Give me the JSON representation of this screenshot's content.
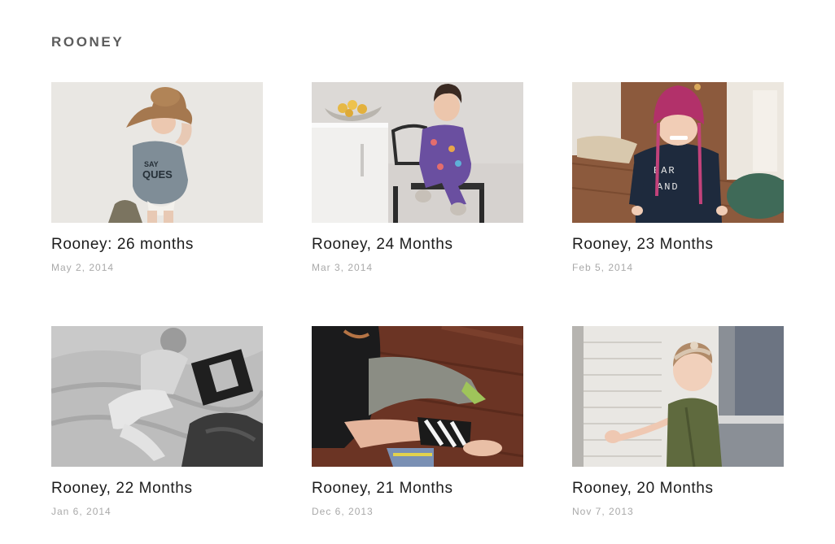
{
  "blog": {
    "title": "ROONEY"
  },
  "posts": [
    {
      "title": "Rooney: 26 months",
      "date": "May 2, 2014",
      "photo": "child-in-big-brown-hat-photo"
    },
    {
      "title": "Rooney, 24 Months",
      "date": "Mar 3, 2014",
      "photo": "child-on-metal-chair-photo"
    },
    {
      "title": "Rooney, 23 Months",
      "date": "Feb 5, 2014",
      "photo": "child-in-pink-knit-hat-photo"
    },
    {
      "title": "Rooney, 22 Months",
      "date": "Jan 6, 2014",
      "photo": "black-and-white-child-on-bed-photo"
    },
    {
      "title": "Rooney, 21 Months",
      "date": "Dec 6, 2013",
      "photo": "child-legs-on-wood-floor-photo"
    },
    {
      "title": "Rooney, 20 Months",
      "date": "Nov 7, 2013",
      "photo": "child-with-headband-by-window-photo"
    }
  ]
}
